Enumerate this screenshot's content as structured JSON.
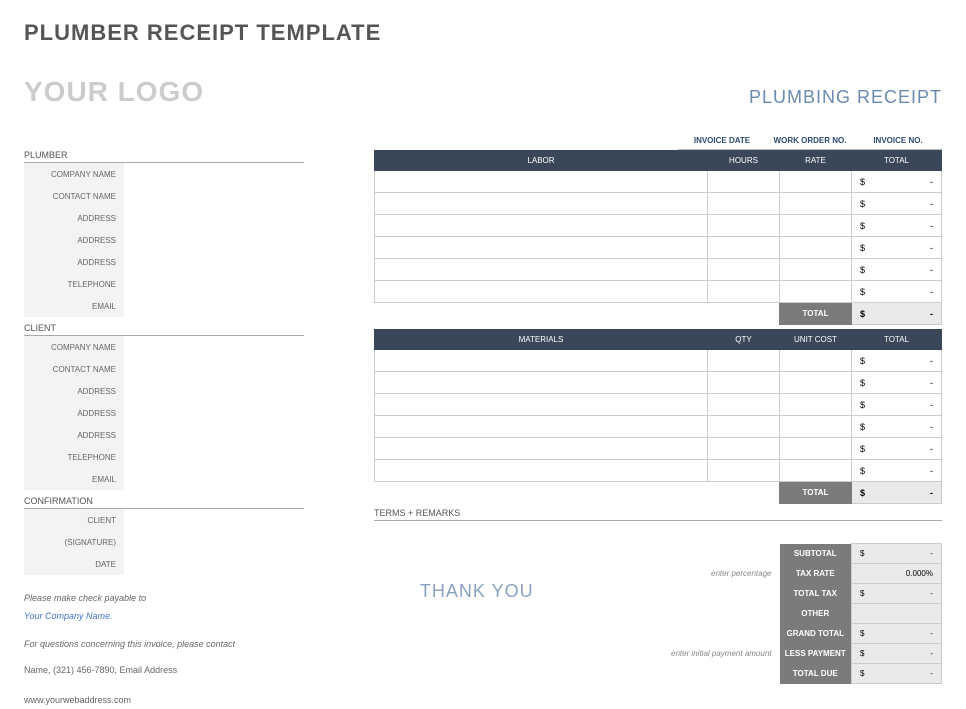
{
  "title": "PLUMBER RECEIPT TEMPLATE",
  "logo": "YOUR LOGO",
  "receipt_title": "PLUMBING RECEIPT",
  "meta": {
    "invoice_date": "INVOICE DATE",
    "work_order": "WORK ORDER NO.",
    "invoice_no": "INVOICE NO."
  },
  "sections": {
    "plumber": "PLUMBER",
    "client": "CLIENT",
    "confirmation": "CONFIRMATION"
  },
  "fields": {
    "company": "COMPANY NAME",
    "contact": "CONTACT NAME",
    "address": "ADDRESS",
    "telephone": "TELEPHONE",
    "email": "EMAIL",
    "client_lbl": "CLIENT",
    "signature": "(SIGNATURE)",
    "date": "DATE"
  },
  "labor": {
    "hdr": {
      "main": "LABOR",
      "hours": "HOURS",
      "rate": "RATE",
      "total": "TOTAL"
    },
    "rows": [
      {
        "sym": "$",
        "dash": "-"
      },
      {
        "sym": "$",
        "dash": "-"
      },
      {
        "sym": "$",
        "dash": "-"
      },
      {
        "sym": "$",
        "dash": "-"
      },
      {
        "sym": "$",
        "dash": "-"
      },
      {
        "sym": "$",
        "dash": "-"
      }
    ],
    "total_lbl": "TOTAL",
    "total_val": {
      "sym": "$",
      "dash": "-"
    }
  },
  "materials": {
    "hdr": {
      "main": "MATERIALS",
      "qty": "QTY",
      "unit": "UNIT COST",
      "total": "TOTAL"
    },
    "rows": [
      {
        "sym": "$",
        "dash": "-"
      },
      {
        "sym": "$",
        "dash": "-"
      },
      {
        "sym": "$",
        "dash": "-"
      },
      {
        "sym": "$",
        "dash": "-"
      },
      {
        "sym": "$",
        "dash": "-"
      },
      {
        "sym": "$",
        "dash": "-"
      }
    ],
    "total_lbl": "TOTAL",
    "total_val": {
      "sym": "$",
      "dash": "-"
    }
  },
  "terms": "TERMS + REMARKS",
  "summary": {
    "subtotal": {
      "lbl": "SUBTOTAL",
      "sym": "$",
      "dash": "-"
    },
    "taxrate": {
      "lbl": "TAX RATE",
      "val": "0.000%",
      "hint": "enter percentage"
    },
    "totaltax": {
      "lbl": "TOTAL TAX",
      "sym": "$",
      "dash": "-"
    },
    "other": {
      "lbl": "OTHER"
    },
    "grand": {
      "lbl": "GRAND TOTAL",
      "sym": "$",
      "dash": "-"
    },
    "less": {
      "lbl": "LESS PAYMENT",
      "sym": "$",
      "dash": "-",
      "hint": "enter initial payment amount"
    },
    "due": {
      "lbl": "TOTAL DUE",
      "sym": "$",
      "dash": "-"
    }
  },
  "payable": {
    "l1": "Please make check payable to",
    "l2": "Your Company Name.",
    "l3": "For questions concerning this invoice, please contact",
    "l4": "Name, (321) 456-7890, Email Address",
    "l5": "www.yourwebaddress.com"
  },
  "thankyou": "THANK YOU"
}
